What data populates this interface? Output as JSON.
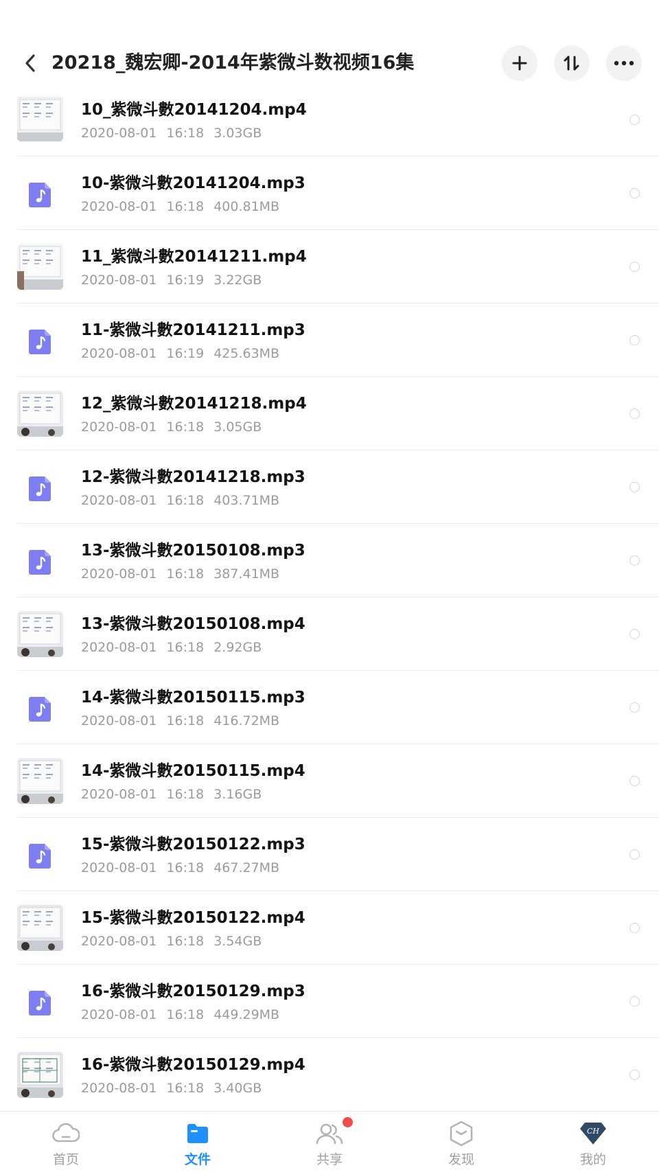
{
  "header": {
    "title": "20218_魏宏卿-2014年紫微斗数视频16集",
    "back_icon": "chevron-left-icon",
    "add_icon": "plus-icon",
    "sort_icon": "sort-icon",
    "more_icon": "more-dots-icon"
  },
  "files": [
    {
      "name": "10_紫微斗數20141204.mp4",
      "date": "2020-08-01",
      "time": "16:18",
      "size": "3.03GB",
      "type": "video",
      "thumb": "a"
    },
    {
      "name": "10-紫微斗數20141204.mp3",
      "date": "2020-08-01",
      "time": "16:18",
      "size": "400.81MB",
      "type": "audio"
    },
    {
      "name": "11_紫微斗數20141211.mp4",
      "date": "2020-08-01",
      "time": "16:19",
      "size": "3.22GB",
      "type": "video",
      "thumb": "b"
    },
    {
      "name": "11-紫微斗數20141211.mp3",
      "date": "2020-08-01",
      "time": "16:19",
      "size": "425.63MB",
      "type": "audio"
    },
    {
      "name": "12_紫微斗數20141218.mp4",
      "date": "2020-08-01",
      "time": "16:18",
      "size": "3.05GB",
      "type": "video",
      "thumb": "c"
    },
    {
      "name": "12-紫微斗數20141218.mp3",
      "date": "2020-08-01",
      "time": "16:18",
      "size": "403.71MB",
      "type": "audio"
    },
    {
      "name": "13-紫微斗數20150108.mp3",
      "date": "2020-08-01",
      "time": "16:18",
      "size": "387.41MB",
      "type": "audio"
    },
    {
      "name": "13-紫微斗數20150108.mp4",
      "date": "2020-08-01",
      "time": "16:18",
      "size": "2.92GB",
      "type": "video",
      "thumb": "c"
    },
    {
      "name": "14-紫微斗數20150115.mp3",
      "date": "2020-08-01",
      "time": "16:18",
      "size": "416.72MB",
      "type": "audio"
    },
    {
      "name": "14-紫微斗數20150115.mp4",
      "date": "2020-08-01",
      "time": "16:18",
      "size": "3.16GB",
      "type": "video",
      "thumb": "c"
    },
    {
      "name": "15-紫微斗數20150122.mp3",
      "date": "2020-08-01",
      "time": "16:18",
      "size": "467.27MB",
      "type": "audio"
    },
    {
      "name": "15-紫微斗數20150122.mp4",
      "date": "2020-08-01",
      "time": "16:18",
      "size": "3.54GB",
      "type": "video",
      "thumb": "d"
    },
    {
      "name": "16-紫微斗數20150129.mp3",
      "date": "2020-08-01",
      "time": "16:18",
      "size": "449.29MB",
      "type": "audio"
    },
    {
      "name": "16-紫微斗數20150129.mp4",
      "date": "2020-08-01",
      "time": "16:18",
      "size": "3.40GB",
      "type": "video",
      "thumb": "e"
    }
  ],
  "bottom_nav": [
    {
      "label": "首页",
      "icon": "cloud-icon",
      "active": false
    },
    {
      "label": "文件",
      "icon": "folder-icon",
      "active": true
    },
    {
      "label": "共享",
      "icon": "people-icon",
      "active": false,
      "badge": true
    },
    {
      "label": "发现",
      "icon": "discover-icon",
      "active": false
    },
    {
      "label": "我的",
      "icon": "profile-badge-icon",
      "active": false,
      "badge_text": "CH"
    }
  ],
  "colors": {
    "accent": "#1e90ff",
    "audio_icon": "#7f7ef0",
    "notification": "#f24b4b",
    "meta_text": "#9b9b9b"
  }
}
